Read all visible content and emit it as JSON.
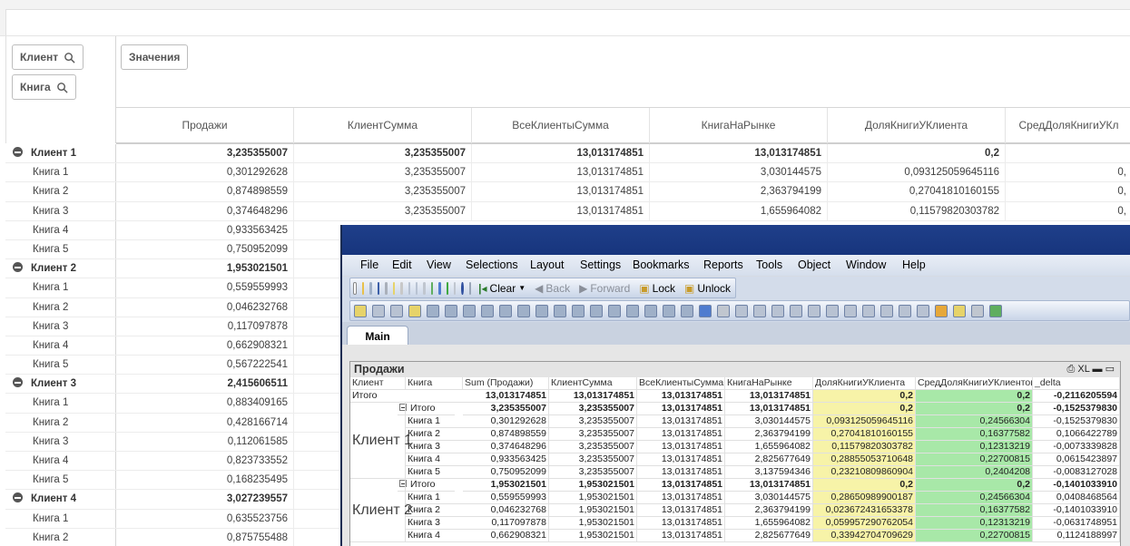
{
  "filters": {
    "dims": [
      "Клиент",
      "Книга"
    ],
    "values_label": "Значения"
  },
  "columns": [
    "Продажи",
    "КлиентСумма",
    "ВсеКлиентыСумма",
    "КнигаНаРынке",
    "ДоляКнигиУКлиента",
    "СредДоляКнигиУКл"
  ],
  "rows": [
    {
      "label": "Клиент 1",
      "group": true,
      "vals": [
        "3,235355007",
        "3,235355007",
        "13,013174851",
        "13,013174851",
        "0,2",
        ""
      ]
    },
    {
      "label": "Книга 1",
      "vals": [
        "0,301292628",
        "3,235355007",
        "13,013174851",
        "3,030144575",
        "0,093125059645116",
        "0,"
      ]
    },
    {
      "label": "Книга 2",
      "vals": [
        "0,874898559",
        "3,235355007",
        "13,013174851",
        "2,363794199",
        "0,27041810160155",
        "0,"
      ]
    },
    {
      "label": "Книга 3",
      "vals": [
        "0,374648296",
        "3,235355007",
        "13,013174851",
        "1,655964082",
        "0,11579820303782",
        "0,"
      ]
    },
    {
      "label": "Книга 4",
      "vals": [
        "0,933563425"
      ]
    },
    {
      "label": "Книга 5",
      "vals": [
        "0,750952099"
      ]
    },
    {
      "label": "Клиент 2",
      "group": true,
      "vals": [
        "1,953021501"
      ]
    },
    {
      "label": "Книга 1",
      "vals": [
        "0,559559993"
      ]
    },
    {
      "label": "Книга 2",
      "vals": [
        "0,046232768"
      ]
    },
    {
      "label": "Книга 3",
      "vals": [
        "0,117097878"
      ]
    },
    {
      "label": "Книга 4",
      "vals": [
        "0,662908321"
      ]
    },
    {
      "label": "Книга 5",
      "vals": [
        "0,567222541"
      ]
    },
    {
      "label": "Клиент 3",
      "group": true,
      "vals": [
        "2,415606511"
      ]
    },
    {
      "label": "Книга 1",
      "vals": [
        "0,883409165"
      ]
    },
    {
      "label": "Книга 2",
      "vals": [
        "0,428166714"
      ]
    },
    {
      "label": "Книга 3",
      "vals": [
        "0,112061585"
      ]
    },
    {
      "label": "Книга 4",
      "vals": [
        "0,823733552"
      ]
    },
    {
      "label": "Книга 5",
      "vals": [
        "0,168235495"
      ]
    },
    {
      "label": "Клиент 4",
      "group": true,
      "vals": [
        "3,027239557"
      ]
    },
    {
      "label": "Книга 1",
      "vals": [
        "0,635523756"
      ]
    },
    {
      "label": "Книга 2",
      "vals": [
        "0,875755488"
      ]
    }
  ],
  "qv": {
    "menu": [
      "File",
      "Edit",
      "View",
      "Selections",
      "Layout",
      "Settings",
      "Bookmarks",
      "Reports",
      "Tools",
      "Object",
      "Window",
      "Help"
    ],
    "toolbar": {
      "clear": "Clear",
      "back": "Back",
      "forward": "Forward",
      "lock": "Lock",
      "unlock": "Unlock"
    },
    "tab": "Main",
    "caption": "Продажи",
    "caption_ctl": "XL",
    "headers": [
      "Клиент",
      "Книга",
      "Sum (Продажи)",
      "КлиентСумма",
      "ВсеКлиентыСумма",
      "КнигаНаРынке",
      "ДоляКнигиУКлиента",
      "СредДоляКнигиУКлиентов",
      "_delta"
    ],
    "total": {
      "c1": "Итого",
      "vals": [
        "13,013174851",
        "13,013174851",
        "13,013174851",
        "13,013174851",
        "0,2",
        "0,2",
        "-0,2116205594"
      ]
    },
    "groups": [
      {
        "client": "Клиент 1",
        "rows": [
          {
            "book": "Итого",
            "bold": true,
            "vals": [
              "3,235355007",
              "3,235355007",
              "13,013174851",
              "13,013174851",
              "0,2",
              "0,2",
              "-0,1525379830"
            ]
          },
          {
            "book": "Книга 1",
            "vals": [
              "0,301292628",
              "3,235355007",
              "13,013174851",
              "3,030144575",
              "0,093125059645116",
              "0,24566304",
              "-0,1525379830"
            ]
          },
          {
            "book": "Книга 2",
            "vals": [
              "0,874898559",
              "3,235355007",
              "13,013174851",
              "2,363794199",
              "0,27041810160155",
              "0,16377582",
              "0,1066422789"
            ]
          },
          {
            "book": "Книга 3",
            "vals": [
              "0,374648296",
              "3,235355007",
              "13,013174851",
              "1,655964082",
              "0,11579820303782",
              "0,12313219",
              "-0,0073339828"
            ]
          },
          {
            "book": "Книга 4",
            "vals": [
              "0,933563425",
              "3,235355007",
              "13,013174851",
              "2,825677649",
              "0,28855053710648",
              "0,22700815",
              "0,0615423897"
            ]
          },
          {
            "book": "Книга 5",
            "vals": [
              "0,750952099",
              "3,235355007",
              "13,013174851",
              "3,137594346",
              "0,23210809860904",
              "0,2404208",
              "-0,0083127028"
            ]
          }
        ]
      },
      {
        "client": "Клиент 2",
        "rows": [
          {
            "book": "Итого",
            "bold": true,
            "vals": [
              "1,953021501",
              "1,953021501",
              "13,013174851",
              "13,013174851",
              "0,2",
              "0,2",
              "-0,1401033910"
            ]
          },
          {
            "book": "Книга 1",
            "vals": [
              "0,559559993",
              "1,953021501",
              "13,013174851",
              "3,030144575",
              "0,28650989900187",
              "0,24566304",
              "0,0408468564"
            ]
          },
          {
            "book": "Книга 2",
            "vals": [
              "0,046232768",
              "1,953021501",
              "13,013174851",
              "2,363794199",
              "0,023672431653378",
              "0,16377582",
              "-0,1401033910"
            ]
          },
          {
            "book": "Книга 3",
            "vals": [
              "0,117097878",
              "1,953021501",
              "13,013174851",
              "1,655964082",
              "0,059957290762054",
              "0,12313219",
              "-0,0631748951"
            ]
          },
          {
            "book": "Книга 4",
            "vals": [
              "0,662908321",
              "1,953021501",
              "13,013174851",
              "2,825677649",
              "0,33942704709629",
              "0,22700815",
              "0,1124188997"
            ]
          }
        ]
      }
    ]
  },
  "colors": {
    "accent": "#1f3f8a",
    "yellow": "#f7f3a8",
    "green": "#a8e8a8"
  }
}
